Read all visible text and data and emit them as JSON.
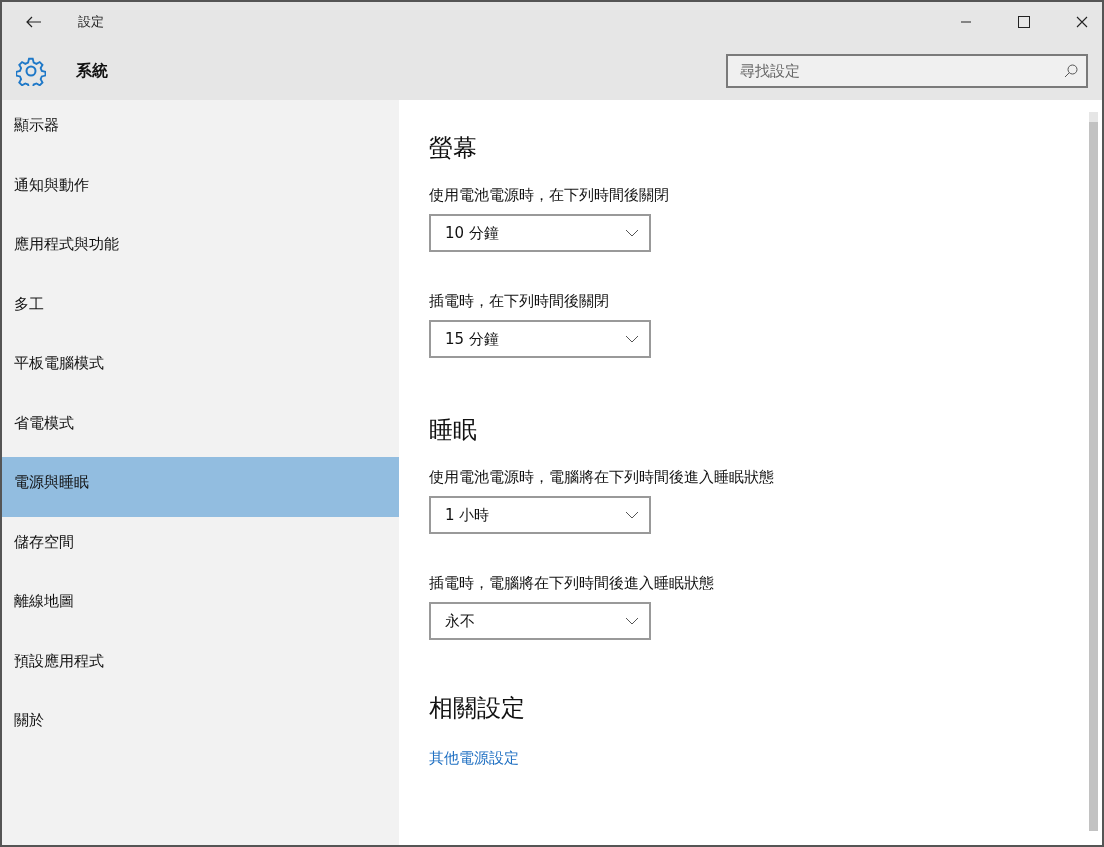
{
  "window": {
    "title": "設定"
  },
  "header": {
    "title": "系統",
    "search": {
      "placeholder": "尋找設定"
    }
  },
  "sidebar": {
    "items": [
      {
        "label": "顯示器",
        "selected": false
      },
      {
        "label": "通知與動作",
        "selected": false
      },
      {
        "label": "應用程式與功能",
        "selected": false
      },
      {
        "label": "多工",
        "selected": false
      },
      {
        "label": "平板電腦模式",
        "selected": false
      },
      {
        "label": "省電模式",
        "selected": false
      },
      {
        "label": "電源與睡眠",
        "selected": true
      },
      {
        "label": "儲存空間",
        "selected": false
      },
      {
        "label": "離線地圖",
        "selected": false
      },
      {
        "label": "預設應用程式",
        "selected": false
      },
      {
        "label": "關於",
        "selected": false
      }
    ]
  },
  "sections": [
    {
      "heading": "螢幕",
      "settings": [
        {
          "label": "使用電池電源時，在下列時間後關閉",
          "value": "10 分鐘"
        },
        {
          "label": "插電時，在下列時間後關閉",
          "value": "15 分鐘"
        }
      ]
    },
    {
      "heading": "睡眠",
      "settings": [
        {
          "label": "使用電池電源時，電腦將在下列時間後進入睡眠狀態",
          "value": "1 小時"
        },
        {
          "label": "插電時，電腦將在下列時間後進入睡眠狀態",
          "value": "永不"
        }
      ]
    }
  ],
  "related": {
    "heading": "相關設定",
    "links": [
      "其他電源設定"
    ]
  }
}
